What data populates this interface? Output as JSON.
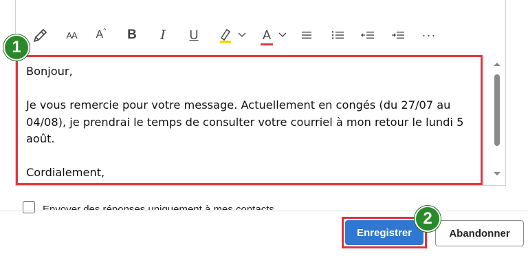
{
  "toolbar": {
    "format_painter_icon": "format-painter-icon",
    "font_size_glyph": "AA",
    "grow_font_glyph": "A",
    "bold_label": "B",
    "italic_label": "I",
    "underline_label": "U",
    "font_color_label": "A",
    "more_label": "···",
    "highlight_color": "#f2d600",
    "font_color": "#e0383f"
  },
  "editor": {
    "lines": [
      "Bonjour,",
      "Je vous remercie pour votre message. Actuellement en congés (du 27/07 au 04/08), je prendrai le temps de consulter votre courriel à mon retour le lundi 5 août.",
      "Cordialement,"
    ],
    "highlight_color": "#e0383f"
  },
  "checkbox": {
    "label": "Envoyer des réponses uniquement à mes contacts"
  },
  "buttons": {
    "save_label": "Enregistrer",
    "cancel_label": "Abandonner",
    "save_color": "#2f77d0"
  },
  "steps": {
    "step1": "1",
    "step2": "2",
    "badge_color": "#2a8a2a"
  }
}
